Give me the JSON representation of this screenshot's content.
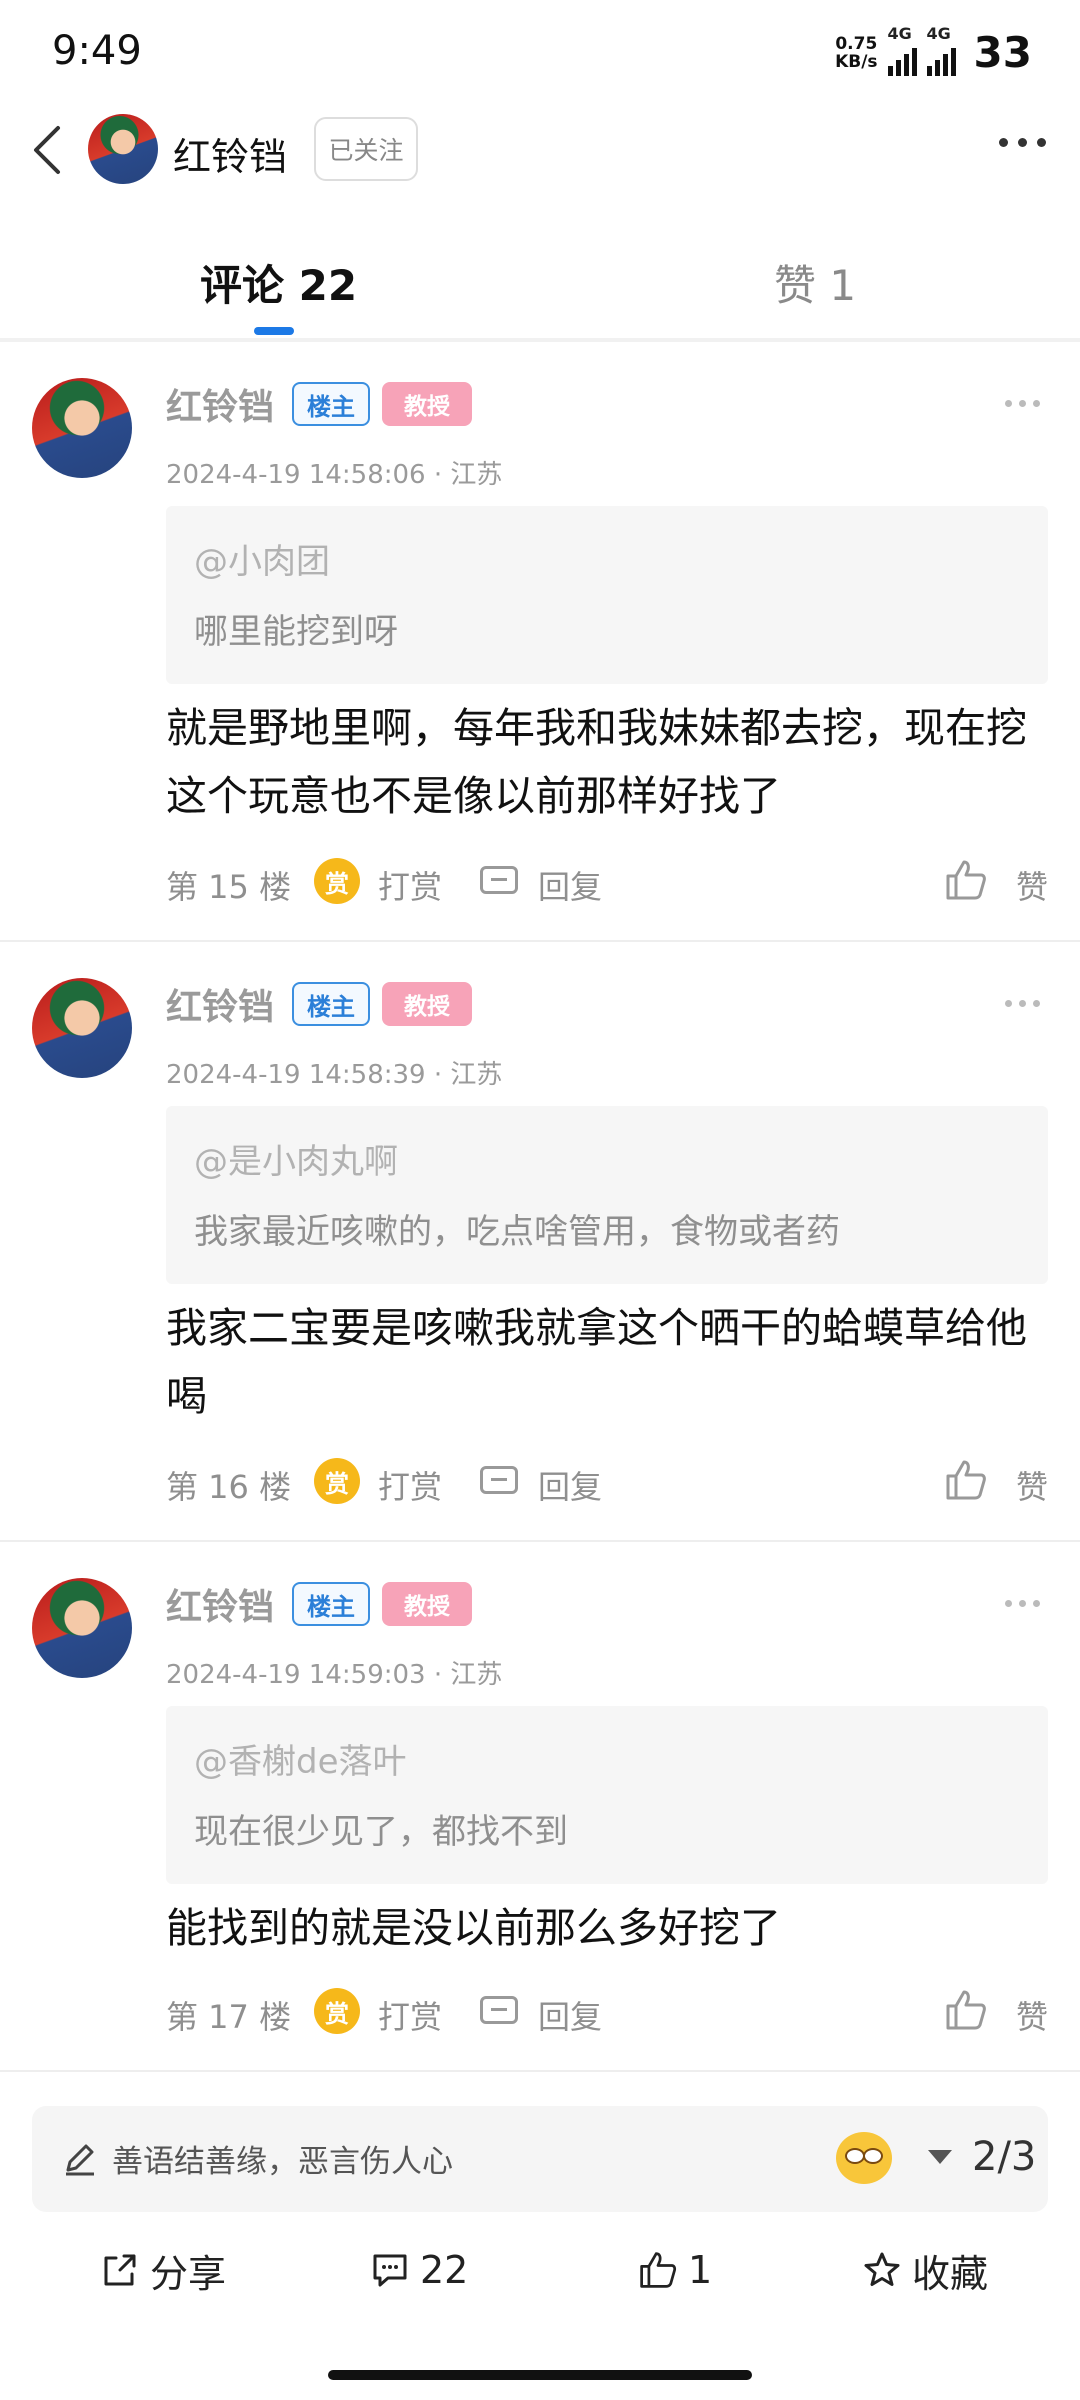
{
  "status_bar": {
    "time": "9:49",
    "net_speed_top": "0.75",
    "net_speed_bottom": "KB/s",
    "sim1": "4G",
    "sim2": "4G",
    "battery": "33"
  },
  "header": {
    "name": "红铃铛",
    "follow_label": "已关注"
  },
  "tabs": [
    {
      "label": "评论 22"
    },
    {
      "label": "赞 1"
    }
  ],
  "comments": [
    {
      "name": "红铃铛",
      "owner_badge": "楼主",
      "title_badge": "教授",
      "meta": "2024-4-19 14:58:06 · 江苏",
      "quote_at": "@小肉团",
      "quote_text": "哪里能挖到呀",
      "body": "就是野地里啊，每年我和我妹妹都去挖，现在挖这个玩意也不是像以前那样好找了",
      "floor": "第 15 楼",
      "reward": "打赏",
      "reply": "回复",
      "like": "赞"
    },
    {
      "name": "红铃铛",
      "owner_badge": "楼主",
      "title_badge": "教授",
      "meta": "2024-4-19 14:58:39 · 江苏",
      "quote_at": "@是小肉丸啊",
      "quote_text": "我家最近咳嗽的，吃点啥管用，食物或者药",
      "body": "我家二宝要是咳嗽我就拿这个晒干的蛤蟆草给他喝",
      "floor": "第 16 楼",
      "reward": "打赏",
      "reply": "回复",
      "like": "赞"
    },
    {
      "name": "红铃铛",
      "owner_badge": "楼主",
      "title_badge": "教授",
      "meta": "2024-4-19 14:59:03 · 江苏",
      "quote_at": "@香榭de落叶",
      "quote_text": "现在很少见了，都找不到",
      "body": "能找到的就是没以前那么多好挖了",
      "floor": "第 17 楼",
      "reward": "打赏",
      "reply": "回复",
      "like": "赞"
    }
  ],
  "reward_icon_text": "赏",
  "input_bar": {
    "placeholder": "善语结善缘，恶言伤人心",
    "page": "2/3"
  },
  "bottom_bar": {
    "share": "分享",
    "comments": "22",
    "likes": "1",
    "favorite": "收藏"
  },
  "colors": {
    "accent": "#1c79e6",
    "owner_badge": "#2b7fd8",
    "title_badge": "#f7a3b8",
    "reward": "#f6b81a"
  }
}
